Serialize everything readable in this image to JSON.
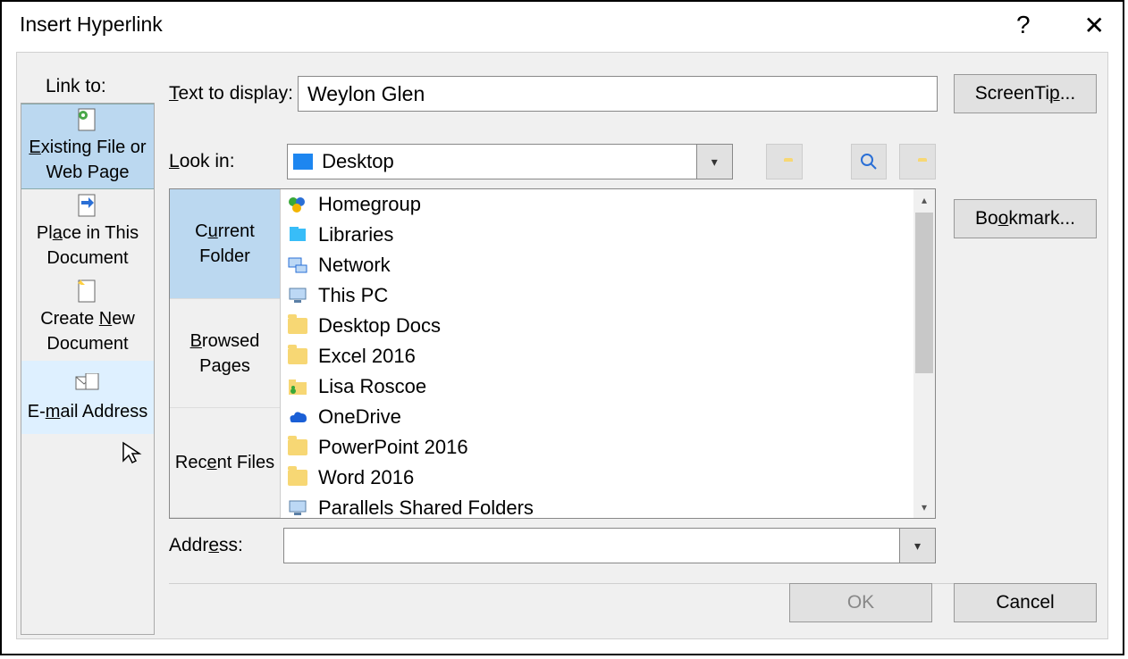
{
  "title": "Insert Hyperlink",
  "linkto_label": "Link to:",
  "linkto": [
    {
      "label_a": "Existing File or",
      "label_b": "Web Page",
      "key": "E"
    },
    {
      "label_a": "Place in This",
      "label_b": "Document",
      "key": "A"
    },
    {
      "label_a": "Create New",
      "label_b": "Document",
      "key": "N"
    },
    {
      "label_a": "E-mail Address",
      "label_b": "",
      "key": "m"
    }
  ],
  "text_to_display_label": "Text to display:",
  "text_to_display_value": "Weylon Glen",
  "screentip_btn": "ScreenTip...",
  "bookmark_btn": "Bookmark...",
  "lookin_label": "Look in:",
  "lookin_value": "Desktop",
  "browse_side": [
    {
      "a": "Current",
      "b": "Folder",
      "key": "u"
    },
    {
      "a": "Browsed",
      "b": "Pages",
      "key": "B"
    },
    {
      "a": "Recent Files",
      "b": "",
      "key": "e"
    }
  ],
  "files": [
    {
      "name": "Homegroup",
      "icon": "homegroup"
    },
    {
      "name": "Libraries",
      "icon": "libraries"
    },
    {
      "name": "Network",
      "icon": "network"
    },
    {
      "name": "This PC",
      "icon": "thispc"
    },
    {
      "name": "Desktop Docs",
      "icon": "folder"
    },
    {
      "name": "Excel 2016",
      "icon": "folder"
    },
    {
      "name": "Lisa Roscoe",
      "icon": "userfolder"
    },
    {
      "name": "OneDrive",
      "icon": "onedrive"
    },
    {
      "name": "PowerPoint 2016",
      "icon": "folder"
    },
    {
      "name": "Word 2016",
      "icon": "folder"
    },
    {
      "name": "Parallels Shared Folders",
      "icon": "thispc"
    }
  ],
  "address_label": "Address:",
  "address_value": "",
  "ok_btn": "OK",
  "cancel_btn": "Cancel"
}
